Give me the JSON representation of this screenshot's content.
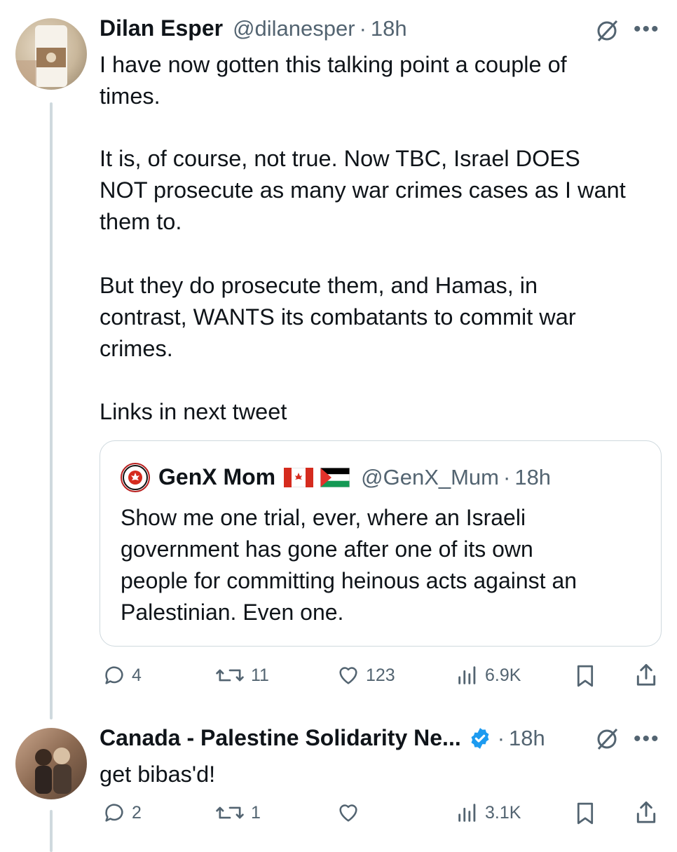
{
  "tweet1": {
    "name": "Dilan Esper",
    "handle": "@dilanesper",
    "separator": "·",
    "time": "18h",
    "paragraphs": [
      "I have now gotten this talking point a couple of\ntimes.",
      "It is, of course, not true. Now TBC, Israel DOES\nNOT prosecute as many war crimes cases as I want\nthem to.",
      "But they do prosecute them, and Hamas, in\ncontrast, WANTS its combatants to commit war\ncrimes.",
      "Links in next tweet"
    ],
    "quote": {
      "name": "GenX Mom",
      "flags": "🇨🇦 🇵🇸",
      "handle": "@GenX_Mum",
      "separator": "·",
      "time": "18h",
      "text": "Show me one trial, ever, where an Israeli\ngovernment has gone after one of its own\npeople for committing heinous acts against an\nPalestinian. Even one.",
      "avatar_text": "PROUD TO BE CANADIAN"
    },
    "actions": {
      "replies": "4",
      "reposts": "11",
      "likes": "123",
      "views": "6.9K"
    }
  },
  "tweet2": {
    "name": "Canada - Palestine Solidarity Ne...",
    "separator": "·",
    "time": "18h",
    "text": "get bibas'd!",
    "actions": {
      "replies": "2",
      "reposts": "1",
      "likes": "",
      "views": "3.1K"
    }
  },
  "colors": {
    "text": "#0f1419",
    "secondary": "#536471",
    "verified": "#1d9bf0",
    "border": "#cfd9de"
  }
}
